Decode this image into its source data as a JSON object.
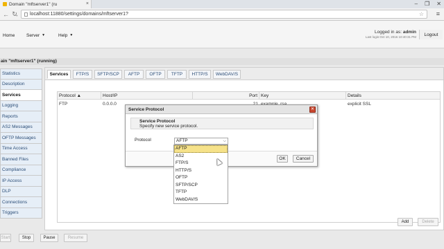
{
  "browser": {
    "tab_title": "Domain \"mftserver1\" (ru",
    "tab_close": "×",
    "url": "localhost:11880/settings/domains/mftserver1?",
    "window_controls": [
      "–",
      "❐",
      "✕"
    ]
  },
  "header": {
    "home": "Home",
    "server": "Server",
    "help": "Help",
    "logged_in_label": "Logged in as:",
    "username": "admin",
    "last_login": "Last login:Oct 10, 2016 10:40:31 PM",
    "logout": "Logout"
  },
  "domain_title": "ain \"mftserver1\" (running)",
  "sidebar": {
    "items": [
      {
        "label": "Statistics"
      },
      {
        "label": "Description"
      },
      {
        "label": "Services",
        "active": true
      },
      {
        "label": "Logging"
      },
      {
        "label": "Reports"
      },
      {
        "label": "AS2 Messages"
      },
      {
        "label": "OFTP Messages"
      },
      {
        "label": "Time Access"
      },
      {
        "label": "Banned Files"
      },
      {
        "label": "Compliance"
      },
      {
        "label": "IP Access"
      },
      {
        "label": "DLP"
      },
      {
        "label": "Connections"
      },
      {
        "label": "Triggers"
      }
    ]
  },
  "subtabs": [
    "Services",
    "FTP/S",
    "SFTP/SCP",
    "AFTP",
    "OFTP",
    "TFTP",
    "HTTP/S",
    "WebDAV/S"
  ],
  "table": {
    "columns": [
      "Protocol ▲",
      "Host/IP",
      "Port",
      "Key",
      "Details"
    ],
    "rows": [
      {
        "protocol": "FTP",
        "host": "0.0.0.0",
        "port": "21",
        "key": "example_rsa",
        "details": "explicit SSL"
      }
    ]
  },
  "table_buttons": {
    "add": "Add",
    "delete": "Delete"
  },
  "bottom_buttons": {
    "start": "Start",
    "stop": "Stop",
    "pause": "Pause",
    "resume": "Resume"
  },
  "modal": {
    "title": "Service Protocol",
    "info_title": "Service Protocol",
    "info_subtitle": "Specify new service protocol.",
    "protocol_label": "Protocol",
    "selected": "AFTP",
    "ok": "OK",
    "cancel": "Cancel"
  },
  "dropdown_options": [
    "AFTP",
    "AS2",
    "FTP/S",
    "HTTP/S",
    "OFTP",
    "SFTP/SCP",
    "TFTP",
    "WebDAV/S"
  ],
  "colors": {
    "accent_link": "#2b4d77",
    "highlight": "#f6e28a",
    "close_red": "#c8462e"
  }
}
